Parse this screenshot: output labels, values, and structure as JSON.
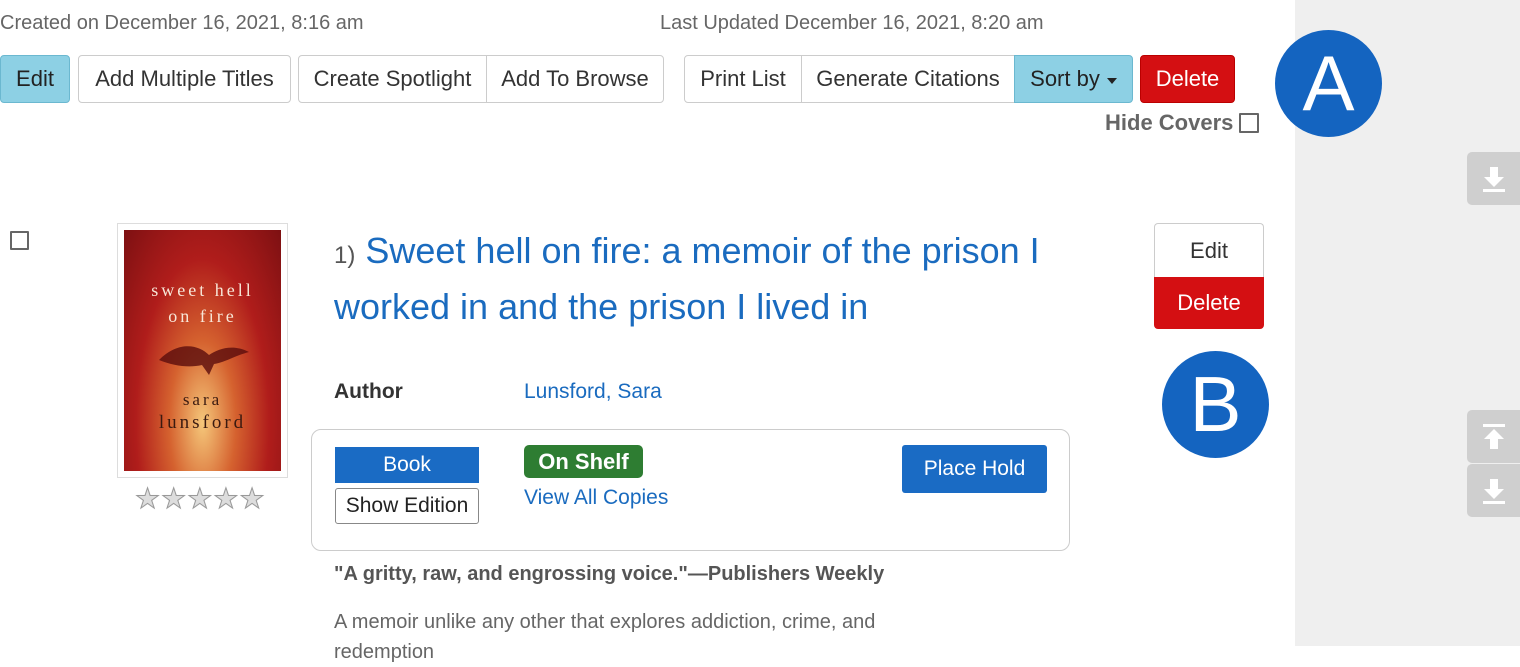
{
  "meta": {
    "created": "Created on December 16, 2021, 8:16 am",
    "updated": "Last Updated December 16, 2021, 8:20 am"
  },
  "toolbar": {
    "edit": "Edit",
    "add_multiple": "Add Multiple Titles",
    "create_spotlight": "Create Spotlight",
    "add_to_browse": "Add To Browse",
    "print_list": "Print List",
    "generate_citations": "Generate Citations",
    "sort_by": "Sort by",
    "delete": "Delete",
    "hide_covers": "Hide Covers"
  },
  "annotations": {
    "a": "A",
    "b": "B"
  },
  "cover": {
    "line1": "sweet hell",
    "line2": "on fire",
    "line3": "sara",
    "line4": "lunsford"
  },
  "item": {
    "number": "1)",
    "title": "Sweet hell on fire: a memoir of the prison I worked in and the prison I lived in",
    "author_label": "Author",
    "author": "Lunsford, Sara",
    "format": "Book",
    "show_edition": "Show Edition",
    "status": "On Shelf",
    "view_copies": "View All Copies",
    "place_hold": "Place Hold",
    "edit": "Edit",
    "delete": "Delete",
    "quote": "\"A gritty, raw, and engrossing voice.\"—Publishers Weekly",
    "description": "A memoir unlike any other that explores addiction, crime, and redemption",
    "rating_stars": 0
  },
  "colors": {
    "teal": "#8dd0e4",
    "red": "#d40f12",
    "link_blue": "#1a6bbf",
    "badge_green": "#2e7d32",
    "annotation_blue": "#1464c0"
  }
}
